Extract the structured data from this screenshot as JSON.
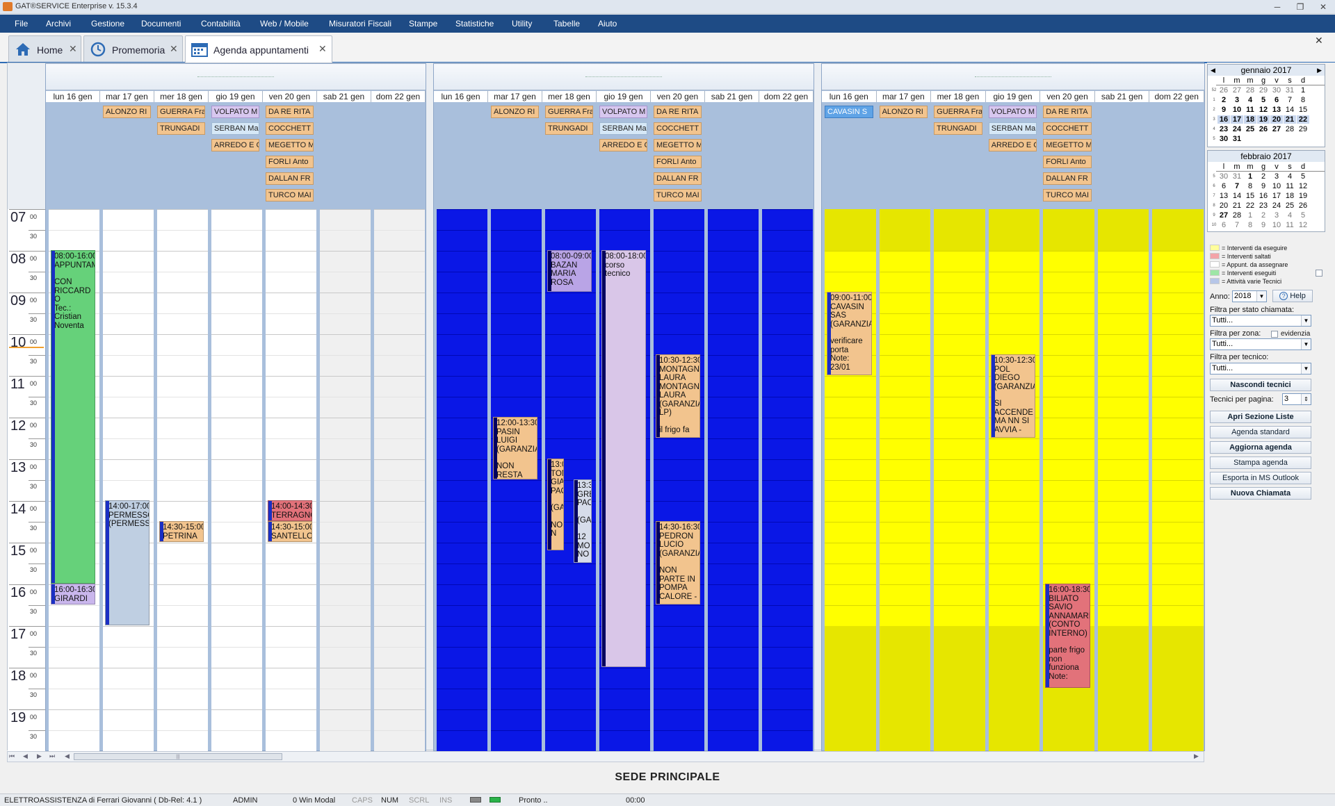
{
  "window": {
    "title": "GAT®SERVICE Enterprise v. 15.3.4",
    "minimize": "─",
    "restore": "❐",
    "close": "✕"
  },
  "menu": [
    "File",
    "Archivi",
    "Gestione",
    "Documenti",
    "Contabilità",
    "Web / Mobile",
    "Misuratori Fiscali",
    "Stampe",
    "Statistiche",
    "Utility",
    "Tabelle",
    "Aiuto"
  ],
  "tabs": [
    {
      "label": "Home",
      "icon": "home-icon"
    },
    {
      "label": "Promemoria",
      "icon": "clock-icon"
    },
    {
      "label": "Agenda appuntamenti",
      "icon": "calendar-icon"
    }
  ],
  "tab_close": "✕",
  "agenda": {
    "hours": [
      "07",
      "08",
      "09",
      "10",
      "11",
      "12",
      "13",
      "14",
      "15",
      "16",
      "17",
      "18",
      "19"
    ],
    "minute_labels": {
      "top": "00",
      "half": "30"
    },
    "days": [
      "lun 16 gen",
      "mar 17 gen",
      "mer 18 gen",
      "gio 19 gen",
      "ven 20 gen",
      "sab 21 gen",
      "dom 22 gen"
    ],
    "resources": [
      {
        "bg": "#ffffff",
        "weekend_bg": "#f0f0f0",
        "allday": [
          [],
          [
            "ALONZO RI"
          ],
          [
            "GUERRA Fra",
            "TRUNGADI"
          ],
          [
            "VOLPATO M",
            "SERBAN Ma",
            "ARREDO E C"
          ],
          [
            "DA RE RITA",
            "COCCHETT",
            "MEGETTO M",
            "FORLI Anto",
            "DALLAN FR",
            "TURCO MAI"
          ],
          [],
          []
        ],
        "events": [
          {
            "day": 0,
            "lines": [
              "08:00-16:00",
              "APPUNTAM",
              "",
              "CON",
              "RICCARD",
              "O",
              "Tec.:",
              "Cristian",
              "Noventa"
            ],
            "color": "#66d17a"
          },
          {
            "day": 0,
            "lines": [
              "16:00-16:30",
              "GIRARDI"
            ],
            "color": "#c9b6ec"
          },
          {
            "day": 1,
            "lines": [
              "14:00-17:00",
              "PERMESSO",
              "(PERMESSO"
            ],
            "color": "#bfcfe2"
          },
          {
            "day": 2,
            "lines": [
              "14:30-15:00",
              "PETRINA"
            ],
            "color": "#f2c48e"
          },
          {
            "day": 4,
            "lines": [
              "14:00-14:30",
              "TERRAGNO"
            ],
            "color": "#e2727a"
          },
          {
            "day": 4,
            "lines": [
              "14:30-15:00",
              "SANTELLO"
            ],
            "color": "#f2c48e"
          }
        ]
      },
      {
        "bg": "#0a17e6",
        "weekend_bg": "#0a17e6",
        "allday": [
          [],
          [
            "ALONZO RI"
          ],
          [
            "GUERRA Fra",
            "TRUNGADI"
          ],
          [
            "VOLPATO M",
            "SERBAN Ma",
            "ARREDO E C"
          ],
          [
            "DA RE RITA",
            "COCCHETT",
            "MEGETTO M",
            "FORLI Anto",
            "DALLAN FR",
            "TURCO MAI"
          ],
          [],
          []
        ],
        "events": [
          {
            "day": 1,
            "lines": [
              "12:00-13:30",
              "PASIN",
              "LUIGI",
              "(GARANZIA",
              "",
              "NON",
              "RESTA"
            ],
            "color": "#f2c48e"
          },
          {
            "day": 2,
            "lines": [
              "08:00-09:00",
              "BAZAN",
              "MARIA",
              "ROSA"
            ],
            "color": "#b9a4e6"
          },
          {
            "day": 2,
            "lines": [
              "13:00",
              "TON",
              "GIA",
              "PAC",
              "",
              "(GA",
              "",
              "NO",
              "N"
            ],
            "color": "#f2c48e"
          },
          {
            "day": 2,
            "lines": [
              "13:30",
              "GRE",
              "PAC",
              "",
              "(GA",
              "",
              "12",
              "MO",
              "NO"
            ],
            "color": "#d6dcea"
          },
          {
            "day": 3,
            "lines": [
              "08:00-18:00",
              "corso",
              "tecnico"
            ],
            "color": "#d9c6e8"
          },
          {
            "day": 4,
            "lines": [
              "10:30-12:30",
              "MONTAGNE",
              "LAURA",
              "MONTAGNE",
              "LAURA",
              "(GARANZIA",
              "LP)",
              "",
              "il frigo fa"
            ],
            "color": "#f2c48e"
          },
          {
            "day": 4,
            "lines": [
              "14:30-16:30",
              "PEDRON",
              "LUCIO",
              "(GARANZIA",
              "",
              "NON",
              "PARTE IN",
              "POMPA",
              "CALORE -"
            ],
            "color": "#f2c48e"
          }
        ]
      },
      {
        "bg": "#ffff00",
        "weekend_bg": "#ffff00",
        "allday": [
          [
            "CAVASIN S"
          ],
          [
            "ALONZO RI"
          ],
          [
            "GUERRA Fra",
            "TRUNGADI"
          ],
          [
            "VOLPATO M",
            "SERBAN Ma",
            "ARREDO E C"
          ],
          [
            "DA RE RITA",
            "COCCHETT",
            "MEGETTO M",
            "FORLI Anto",
            "DALLAN FR",
            "TURCO MAI"
          ],
          [],
          []
        ],
        "events": [
          {
            "day": 0,
            "lines": [
              "09:00-11:00",
              "CAVASIN",
              "SAS",
              "(GARANZIA",
              "",
              "verificare",
              "porta",
              "Note:",
              "23/01"
            ],
            "color": "#f2c48e"
          },
          {
            "day": 3,
            "lines": [
              "10:30-12:30",
              "POL",
              "DIEGO",
              "(GARANZIA",
              "",
              "SI",
              "ACCENDE",
              "MA NN SI",
              "AVVIA -"
            ],
            "color": "#f2c48e"
          },
          {
            "day": 4,
            "lines": [
              "16:00-18:30",
              "BILIATO",
              "SAVIO",
              "ANNAMARI",
              "(CONTO",
              "INTERNO)",
              "",
              "parte frigo",
              "non",
              "funziona",
              "Note:"
            ],
            "color": "#e2727a"
          }
        ]
      }
    ]
  },
  "sidebar": {
    "calendars": [
      {
        "month": "gennaio 2017",
        "dow": [
          "l",
          "m",
          "m",
          "g",
          "v",
          "s",
          "d"
        ],
        "weeks": [
          "52",
          "1",
          "2",
          "3",
          "4",
          "5"
        ],
        "rows": [
          [
            "26",
            "27",
            "28",
            "29",
            "30",
            "31",
            "1"
          ],
          [
            "2",
            "3",
            "4",
            "5",
            "6",
            "7",
            "8"
          ],
          [
            "9",
            "10",
            "11",
            "12",
            "13",
            "14",
            "15"
          ],
          [
            "16",
            "17",
            "18",
            "19",
            "20",
            "21",
            "22"
          ],
          [
            "23",
            "24",
            "25",
            "26",
            "27",
            "28",
            "29"
          ],
          [
            "30",
            "31",
            "",
            "",
            "",
            "",
            ""
          ]
        ]
      },
      {
        "month": "febbraio 2017",
        "dow": [
          "l",
          "m",
          "m",
          "g",
          "v",
          "s",
          "d"
        ],
        "weeks": [
          "5",
          "6",
          "7",
          "8",
          "9",
          "10"
        ],
        "rows": [
          [
            "30",
            "31",
            "1",
            "2",
            "3",
            "4",
            "5"
          ],
          [
            "6",
            "7",
            "8",
            "9",
            "10",
            "11",
            "12"
          ],
          [
            "13",
            "14",
            "15",
            "16",
            "17",
            "18",
            "19"
          ],
          [
            "20",
            "21",
            "22",
            "23",
            "24",
            "25",
            "26"
          ],
          [
            "27",
            "28",
            "1",
            "2",
            "3",
            "4",
            "5"
          ],
          [
            "6",
            "7",
            "8",
            "9",
            "10",
            "11",
            "12"
          ]
        ]
      }
    ],
    "nav_prev": "◀",
    "nav_next": "▶",
    "legend": [
      {
        "label": "= Interventi da eseguire",
        "color": "#fffe9c"
      },
      {
        "label": "= Interventi saltati",
        "color": "#f3a3a8"
      },
      {
        "label": "= Appunt. da assegnare",
        "color": "#ffffff"
      },
      {
        "label": "= Interventi eseguiti",
        "color": "#9ee6a6"
      },
      {
        "label": "= Attività varie Tecnici",
        "color": "#b6c6e8"
      }
    ],
    "anno_label": "Anno:",
    "anno_value": "2018",
    "help_label": "Help",
    "filtro_stato_label": "Filtra per stato chiamata:",
    "filtro_stato_value": "Tutti...",
    "filtro_zona_label": "Filtra per zona:",
    "evidenzia_label": "evidenzia",
    "filtro_zona_value": "Tutti...",
    "filtro_tecnico_label": "Filtra per tecnico:",
    "filtro_tecnico_value": "Tutti...",
    "nascondi_label": "Nascondi tecnici",
    "tecnici_pagina_label": "Tecnici per pagina:",
    "tecnici_pagina_value": "3",
    "buttons": [
      {
        "label": "Apri Sezione Liste",
        "bold": true
      },
      {
        "label": "Agenda standard",
        "bold": false
      },
      {
        "label": "Aggiorna agenda",
        "bold": true
      },
      {
        "label": "Stampa agenda",
        "bold": false
      },
      {
        "label": "Esporta in MS Outlook",
        "bold": false
      },
      {
        "label": "Nuova Chiamata",
        "bold": true
      }
    ]
  },
  "scroll": {
    "first": "⏮",
    "prev": "◀",
    "next": "▶",
    "last": "⏭",
    "left": "◀",
    "right": "▶",
    "grip": "|||"
  },
  "footer_title": "SEDE PRINCIPALE",
  "status": {
    "company": "ELETTROASSISTENZA di Ferrari Giovanni ( Db-Rel: 4.1 )",
    "user": "ADMIN",
    "modal": "0 Win Modal",
    "caps": "CAPS",
    "num": "NUM",
    "scrl": "SCRL",
    "ins": "INS",
    "state": "Pronto ..",
    "time": "00:00"
  }
}
